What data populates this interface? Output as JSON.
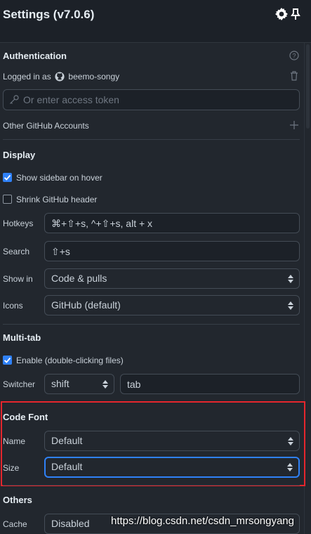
{
  "header": {
    "title": "Settings (v7.0.6)",
    "settings_icon": "gear-icon",
    "pin_icon": "pin-icon"
  },
  "authentication": {
    "title": "Authentication",
    "help_icon": "question-circle-icon",
    "logged_in_prefix": "Logged in as",
    "username": "beemo-songy",
    "token_placeholder": "Or enter access token",
    "other_accounts": "Other GitHub Accounts"
  },
  "display": {
    "title": "Display",
    "show_sidebar": {
      "label": "Show sidebar on hover",
      "checked": true
    },
    "shrink_header": {
      "label": "Shrink GitHub header",
      "checked": false
    },
    "hotkeys": {
      "label": "Hotkeys",
      "value": "⌘+⇧+s, ^+⇧+s, alt + x"
    },
    "search": {
      "label": "Search",
      "value": "⇧+s"
    },
    "show_in": {
      "label": "Show in",
      "value": "Code & pulls"
    },
    "icons": {
      "label": "Icons",
      "value": "GitHub (default)"
    }
  },
  "multitab": {
    "title": "Multi-tab",
    "enable": {
      "label": "Enable (double-clicking files)",
      "checked": true
    },
    "switcher": {
      "label": "Switcher",
      "modifier": "shift",
      "key": "tab"
    }
  },
  "code_font": {
    "title": "Code Font",
    "name": {
      "label": "Name",
      "value": "Default"
    },
    "size": {
      "label": "Size",
      "value": "Default"
    }
  },
  "others": {
    "title": "Others",
    "cache": {
      "label": "Cache",
      "value": "Disabled"
    }
  },
  "watermark": "https://blog.csdn.net/csdn_mrsongyang",
  "colors": {
    "accent": "#2f81f7",
    "highlight_box": "#e5262d",
    "background": "#22272e"
  }
}
